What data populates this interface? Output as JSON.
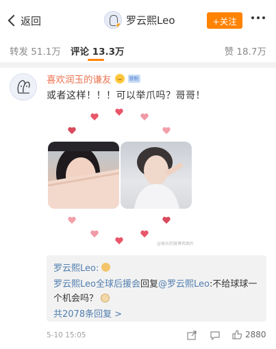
{
  "header": {
    "back_label": "返回",
    "title": "罗云熙Leo",
    "follow_label": "+关注"
  },
  "tabs": {
    "repost": "转发 51.1万",
    "comment": "评论 13.3万",
    "like": "赞 18.7万"
  },
  "comment": {
    "username": "喜欢润玉的谦友",
    "level_badge": "铁粉",
    "text": "或者这样！！！可以举爪吗？哥哥！",
    "watermark": "@很长的微博名图片",
    "timestamp": "5-10 15:05",
    "like_count": "2880"
  },
  "replies": {
    "first_author": "罗云熙Leo:",
    "second_author": "罗云熙Leo全球后援会",
    "second_reply_word": "回复",
    "second_mention": "@罗云熙Leo",
    "second_text": ":不给球球一个机会吗？",
    "more": "共2078条回复 >"
  },
  "colors": {
    "accent": "#ff8200",
    "username": "#eb7350",
    "link": "#507daf",
    "heart": "#e8576a"
  },
  "icons": [
    "back-icon",
    "more-icon",
    "share-icon",
    "comment-icon",
    "thumbs-up-icon",
    "heart-icon"
  ]
}
